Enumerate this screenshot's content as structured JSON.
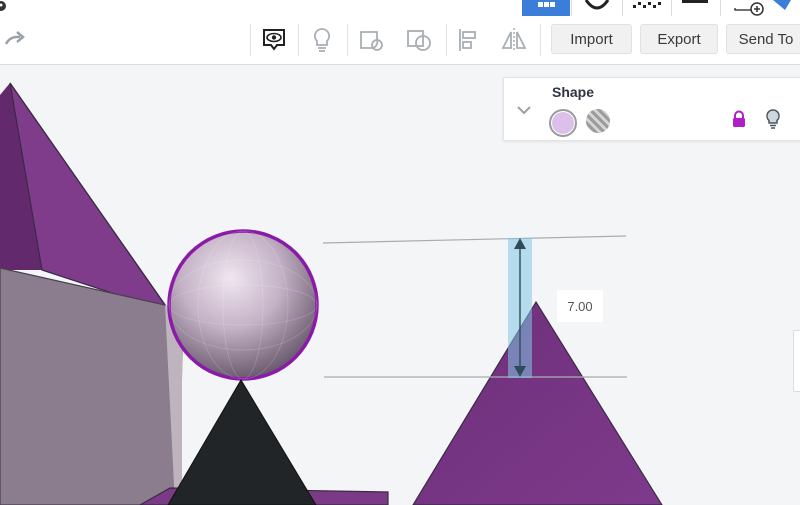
{
  "toolbar": {
    "import_label": "Import",
    "export_label": "Export",
    "send_to_label": "Send To",
    "icons": [
      "redo-arrow-icon",
      "show-all-icon",
      "hide-bulb-icon",
      "group-icon",
      "ungroup-icon",
      "align-icon",
      "mirror-icon"
    ]
  },
  "shape_panel": {
    "title": "Shape",
    "solid_color": "#dcc0ea",
    "locked": true
  },
  "measurement": {
    "value": "7.00"
  },
  "colors": {
    "accent": "#3b7ed9",
    "shape_purple": "#7a3a85",
    "selection_outline": "#8a1aa8",
    "lock": "#b01ec8"
  }
}
